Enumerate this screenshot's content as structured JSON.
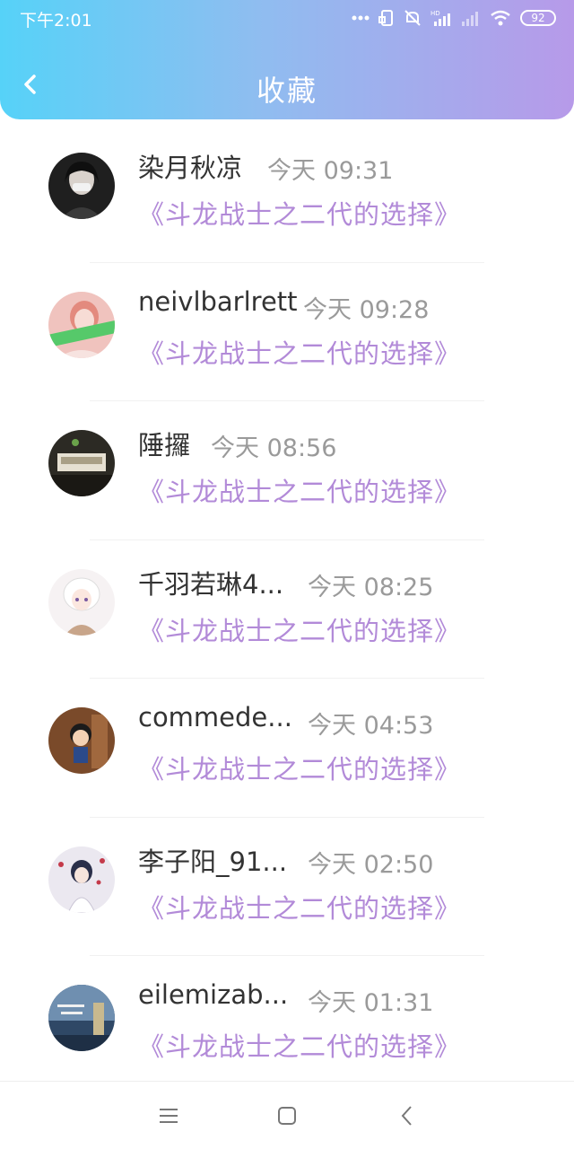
{
  "status_bar": {
    "time": "下午2:01",
    "battery": "92",
    "icons": [
      "more-dots-icon",
      "rotate-icon",
      "mute-icon",
      "hd-signal-icon",
      "signal-icon",
      "wifi-icon",
      "battery-icon"
    ]
  },
  "header": {
    "title": "收藏",
    "back_icon": "chevron-left-icon",
    "gradient_colors": [
      "#56d2f8",
      "#b79ae9"
    ]
  },
  "items": [
    {
      "name": "染月秋凉",
      "time": "今天 09:31",
      "title": "《斗龙战士之二代的选择》",
      "avatar_color": "#2a2a2a"
    },
    {
      "name": "neivlbarlrett",
      "time": "今天 09:28",
      "title": "《斗龙战士之二代的选择》",
      "avatar_color": "#e7a6a0"
    },
    {
      "name": "陲攞",
      "time": "今天 08:56",
      "title": "《斗龙战士之二代的选择》",
      "avatar_color": "#3b3b36"
    },
    {
      "name": "千羽若琳4...",
      "time": "今天 08:25",
      "title": "《斗龙战士之二代的选择》",
      "avatar_color": "#efe7ea"
    },
    {
      "name": "commede...",
      "time": "今天 04:53",
      "title": "《斗龙战士之二代的选择》",
      "avatar_color": "#6a3b22"
    },
    {
      "name": "李子阳_91...",
      "time": "今天 02:50",
      "title": "《斗龙战士之二代的选择》",
      "avatar_color": "#d9d6e4"
    },
    {
      "name": "eilemizab...",
      "time": "今天 01:31",
      "title": "《斗龙战士之二代的选择》",
      "avatar_color": "#3f5b78"
    }
  ],
  "bottom_nav": {
    "icons": [
      "menu-icon",
      "home-square-icon",
      "back-chevron-icon"
    ]
  },
  "colors": {
    "accent_title": "#b28ad8",
    "time_text": "#9a9a9a",
    "name_text": "#333333"
  }
}
